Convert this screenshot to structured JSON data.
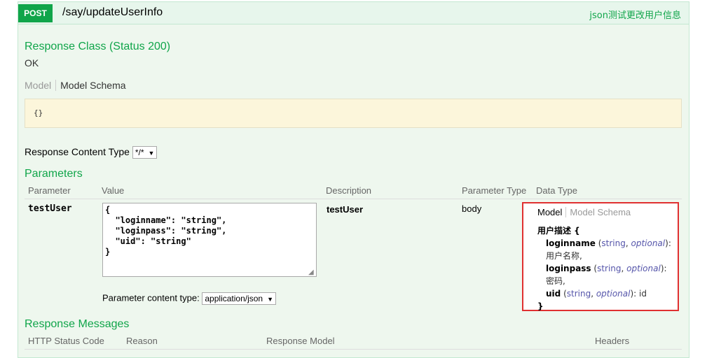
{
  "operation": {
    "method": "POST",
    "path": "/say/updateUserInfo",
    "summary": "json测试更改用户信息"
  },
  "response_class": {
    "title": "Response Class (Status 200)",
    "status_text": "OK",
    "tabs": {
      "model": "Model",
      "schema": "Model Schema"
    },
    "signature": "{}"
  },
  "response_content_type": {
    "label": "Response Content Type",
    "selected": "*/*"
  },
  "parameters": {
    "title": "Parameters",
    "headers": [
      "Parameter",
      "Value",
      "Description",
      "Parameter Type",
      "Data Type"
    ],
    "rows": [
      {
        "name": "testUser",
        "value": "{\n  \"loginname\": \"string\",\n  \"loginpass\": \"string\",\n  \"uid\": \"string\"\n}",
        "description": "testUser",
        "param_type": "body",
        "content_type_label": "Parameter content type:",
        "content_type_selected": "application/json",
        "data_type": {
          "tab_model": "Model",
          "tab_schema": "Model Schema",
          "model_name": "用户描述 {",
          "fields": [
            {
              "name": "loginname",
              "type": "string",
              "optional": "optional",
              "desc": ": 用户名称,"
            },
            {
              "name": "loginpass",
              "type": "string",
              "optional": "optional",
              "desc": ": 密码,"
            },
            {
              "name": "uid",
              "type": "string",
              "optional": "optional",
              "desc": ": id"
            }
          ],
          "close": "}"
        }
      }
    ]
  },
  "response_messages": {
    "title": "Response Messages",
    "headers": [
      "HTTP Status Code",
      "Reason",
      "Response Model",
      "Headers"
    ]
  },
  "colors": {
    "post_green": "#10a54a",
    "highlight_red": "#e03030",
    "signature_bg": "#fcf6db"
  }
}
